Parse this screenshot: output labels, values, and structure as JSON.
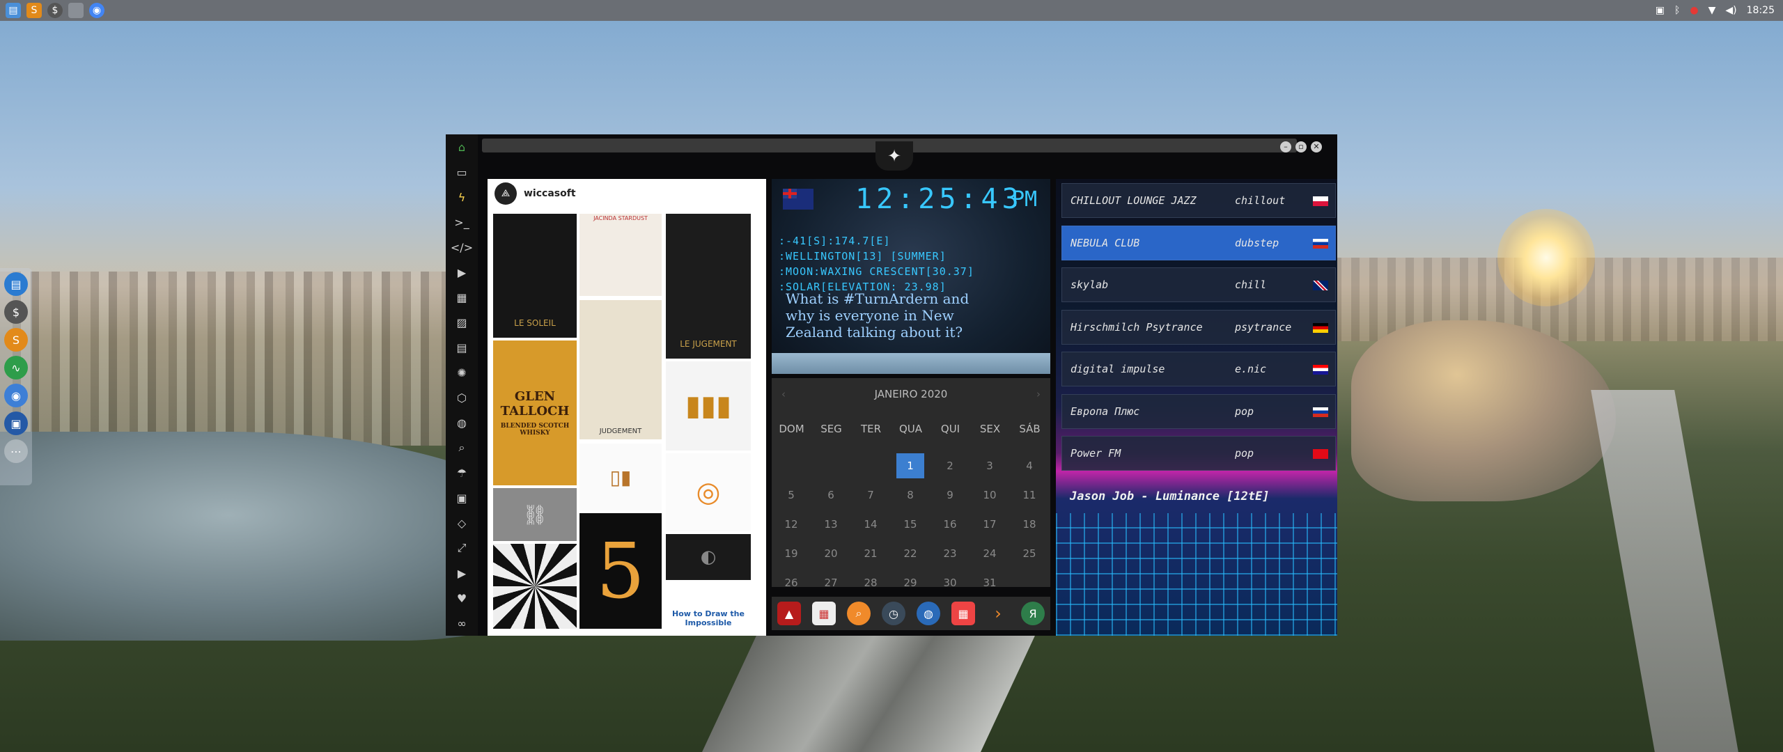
{
  "taskbar": {
    "left_icons": [
      "files-icon",
      "sublime-icon",
      "terminal-app-icon",
      "workspace-icon",
      "chrome-icon"
    ],
    "tray_icons": [
      "screen-icon",
      "bluetooth-icon",
      "record-icon",
      "wifi-icon",
      "volume-icon"
    ],
    "time": "18:25"
  },
  "dock": {
    "items": [
      "files-icon",
      "money-icon",
      "sublime-icon",
      "activity-icon",
      "chromium-icon",
      "remote-icon",
      "more-icon"
    ]
  },
  "sidebar": {
    "items": [
      "home-icon",
      "document-icon",
      "bolt-icon",
      "terminal-icon",
      "code-icon",
      "play-icon",
      "gallery-icon",
      "image-icon",
      "news-icon",
      "hex-icon",
      "hexagon-icon",
      "globe-icon",
      "search-icon",
      "umbrella-icon",
      "contact-icon",
      "code-alt-icon",
      "expand-icon",
      "youtube-icon",
      "heart-icon",
      "link-icon"
    ]
  },
  "instagram": {
    "username": "wiccasoft",
    "tiles": {
      "le_soleil": "LE SOLEIL",
      "jacinda": "JACINDA STARDUST",
      "le_jugement": "LE JUGEMENT",
      "glen": "GLEN TALLOCH",
      "glen_sub": "BLENDED SCOTCH WHISKY",
      "judgement": "JUDGEMENT",
      "how_to": "How to Draw the Impossible",
      "five": "5"
    }
  },
  "clock": {
    "time": "12:25:43",
    "ampm": "PM",
    "info_lines": [
      ":-41[S]:174.7[E]",
      ":WELLINGTON[13] [SUMMER]",
      ":MOON:WAXING CRESCENT[30.37]",
      ":SOLAR[ELEVATION: 23.98]"
    ],
    "headline": "What is #TurnArdern and why is everyone in New Zealand talking about it?"
  },
  "calendar": {
    "title": "JANEIRO 2020",
    "weekdays": [
      "DOM",
      "SEG",
      "TER",
      "QUA",
      "QUI",
      "SEX",
      "SÁB"
    ],
    "today": "1",
    "weeks": [
      [
        "",
        "",
        "",
        "1",
        "2",
        "3",
        "4"
      ],
      [
        "5",
        "6",
        "7",
        "8",
        "9",
        "10",
        "11"
      ],
      [
        "12",
        "13",
        "14",
        "15",
        "16",
        "17",
        "18"
      ],
      [
        "19",
        "20",
        "21",
        "22",
        "23",
        "24",
        "25"
      ],
      [
        "26",
        "27",
        "28",
        "29",
        "30",
        "31",
        ""
      ]
    ]
  },
  "launcher": {
    "items": [
      "alert-icon",
      "calendar-app-icon",
      "search-app-icon",
      "clock-app-icon",
      "globe-app-icon",
      "calendar-alt-icon",
      "arrow-app-icon",
      "yandex-icon"
    ]
  },
  "radio": {
    "stations": [
      {
        "name": "CHILLOUT LOUNGE JAZZ",
        "genre": "chillout",
        "flag": "pl"
      },
      {
        "name": "NEBULA CLUB",
        "genre": "dubstep",
        "flag": "ru"
      },
      {
        "name": "skylab",
        "genre": "chill",
        "flag": "gb"
      },
      {
        "name": "Hirschmilch Psytrance",
        "genre": "psytrance",
        "flag": "de"
      },
      {
        "name": "digital impulse",
        "genre": "e.nic",
        "flag": "hr"
      },
      {
        "name": "Европа Плюс",
        "genre": "pop",
        "flag": "ru"
      },
      {
        "name": "Power FM",
        "genre": "pop",
        "flag": "tr"
      }
    ],
    "now_playing": "Jason Job - Luminance [12tE]"
  },
  "colors": {
    "accent_blue": "#38c8ff",
    "active_station": "#2a66c8",
    "calendar_today": "#3c7fd0"
  }
}
